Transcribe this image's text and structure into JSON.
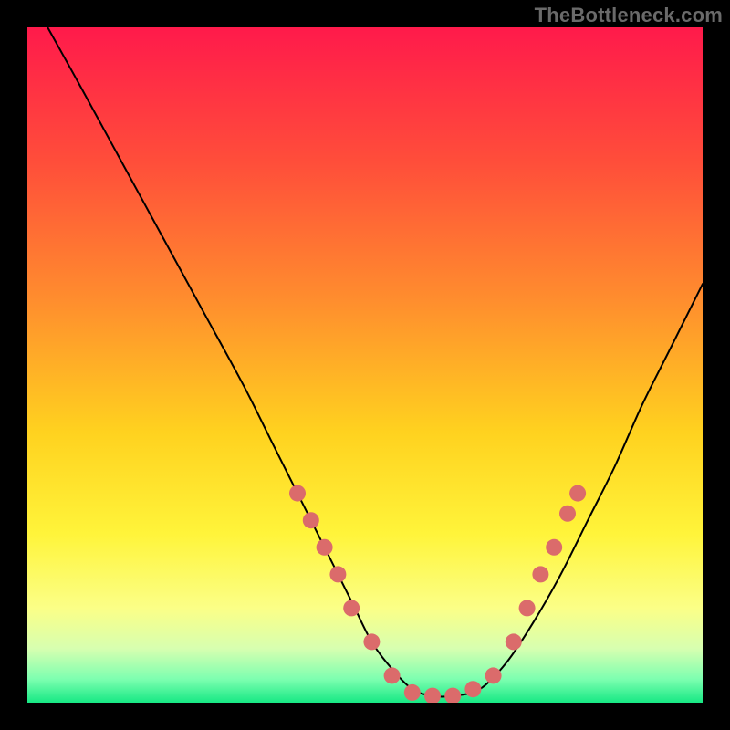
{
  "attribution": "TheBottleneck.com",
  "chart_data": {
    "type": "line",
    "title": "",
    "xlabel": "",
    "ylabel": "",
    "xlim": [
      0,
      100
    ],
    "ylim": [
      0,
      100
    ],
    "grid": false,
    "legend": false,
    "background_gradient_stops": [
      {
        "offset": 0.0,
        "color": "#ff1a4b"
      },
      {
        "offset": 0.2,
        "color": "#ff4e3a"
      },
      {
        "offset": 0.4,
        "color": "#ff8c2e"
      },
      {
        "offset": 0.6,
        "color": "#ffd21f"
      },
      {
        "offset": 0.75,
        "color": "#fff43a"
      },
      {
        "offset": 0.86,
        "color": "#fbff87"
      },
      {
        "offset": 0.92,
        "color": "#d7ffb0"
      },
      {
        "offset": 0.965,
        "color": "#7dffb0"
      },
      {
        "offset": 1.0,
        "color": "#17e884"
      }
    ],
    "series": [
      {
        "name": "curve",
        "color": "#000000",
        "stroke_width": 2,
        "x": [
          3,
          8,
          14,
          20,
          26,
          32,
          36,
          40,
          44,
          48,
          51,
          54,
          57,
          60,
          63,
          67,
          71,
          75,
          79,
          83,
          87,
          91,
          95,
          100
        ],
        "y": [
          100,
          91,
          80,
          69,
          58,
          47,
          39,
          31,
          23,
          15,
          9,
          5,
          2,
          1,
          1,
          2,
          6,
          12,
          19,
          27,
          35,
          44,
          52,
          62
        ]
      }
    ],
    "markers": {
      "name": "highlight-points",
      "color": "#db6b6b",
      "radius": 9,
      "points": [
        {
          "x": 40,
          "y": 31
        },
        {
          "x": 42,
          "y": 27
        },
        {
          "x": 44,
          "y": 23
        },
        {
          "x": 46,
          "y": 19
        },
        {
          "x": 48,
          "y": 14
        },
        {
          "x": 51,
          "y": 9
        },
        {
          "x": 54,
          "y": 4
        },
        {
          "x": 57,
          "y": 1.5
        },
        {
          "x": 60,
          "y": 1
        },
        {
          "x": 63,
          "y": 1
        },
        {
          "x": 66,
          "y": 2
        },
        {
          "x": 69,
          "y": 4
        },
        {
          "x": 72,
          "y": 9
        },
        {
          "x": 74,
          "y": 14
        },
        {
          "x": 76,
          "y": 19
        },
        {
          "x": 78,
          "y": 23
        },
        {
          "x": 80,
          "y": 28
        },
        {
          "x": 81.5,
          "y": 31
        }
      ]
    }
  }
}
